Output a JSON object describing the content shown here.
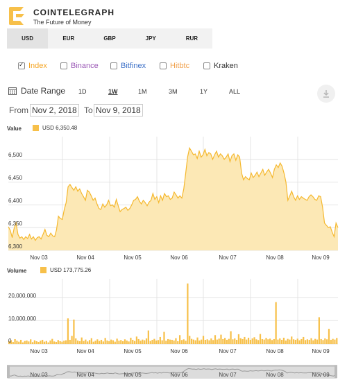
{
  "header": {
    "brand": "COINTELEGRAPH",
    "tagline": "The Future of Money"
  },
  "currencies": [
    {
      "label": "USD",
      "active": true
    },
    {
      "label": "EUR",
      "active": false
    },
    {
      "label": "GBP",
      "active": false
    },
    {
      "label": "JPY",
      "active": false
    },
    {
      "label": "RUR",
      "active": false
    }
  ],
  "exchanges": [
    {
      "label": "Index",
      "checked": true,
      "color": "#f5a524"
    },
    {
      "label": "Binance",
      "checked": false,
      "color": "#9b59b6"
    },
    {
      "label": "Bitfinex",
      "checked": false,
      "color": "#3b6fc7"
    },
    {
      "label": "Hitbtc",
      "checked": false,
      "color": "#f0a04b"
    },
    {
      "label": "Kraken",
      "checked": false,
      "color": "#333333"
    }
  ],
  "date_range": {
    "label": "Date Range",
    "ranges": [
      {
        "label": "1D",
        "active": false
      },
      {
        "label": "1W",
        "active": true
      },
      {
        "label": "1M",
        "active": false
      },
      {
        "label": "3M",
        "active": false
      },
      {
        "label": "1Y",
        "active": false
      },
      {
        "label": "ALL",
        "active": false
      }
    ],
    "from_label": "From",
    "from_value": "Nov 2, 2018",
    "to_label": "To",
    "to_value": "Nov 9, 2018"
  },
  "icons": {
    "logo": "cointelegraph-logo-icon",
    "calendar": "calendar-icon",
    "download": "download-icon"
  },
  "colors": {
    "accent": "#f7c04a",
    "line": "#f5b82e",
    "fill": "#fce8b5"
  },
  "chart_data": [
    {
      "type": "area",
      "title": "Value",
      "legend": "USD 6,350.48",
      "yticks": [
        "6,500",
        "6,450",
        "6,400",
        "6,350",
        "6,300"
      ],
      "ylim": [
        6300,
        6550
      ],
      "xticks": [
        "Nov 03",
        "Nov 04",
        "Nov 05",
        "Nov 06",
        "Nov 07",
        "Nov 08",
        "Nov 09"
      ],
      "values": [
        6352,
        6344,
        6328,
        6348,
        6360,
        6335,
        6327,
        6330,
        6324,
        6330,
        6326,
        6335,
        6325,
        6330,
        6322,
        6328,
        6330,
        6325,
        6335,
        6346,
        6333,
        6330,
        6338,
        6332,
        6330,
        6345,
        6375,
        6370,
        6368,
        6390,
        6405,
        6440,
        6445,
        6438,
        6432,
        6440,
        6430,
        6435,
        6425,
        6418,
        6410,
        6432,
        6428,
        6420,
        6410,
        6415,
        6402,
        6392,
        6390,
        6402,
        6395,
        6400,
        6410,
        6398,
        6400,
        6395,
        6412,
        6398,
        6385,
        6390,
        6392,
        6395,
        6388,
        6392,
        6400,
        6410,
        6412,
        6418,
        6408,
        6402,
        6410,
        6405,
        6398,
        6406,
        6410,
        6425,
        6412,
        6418,
        6405,
        6420,
        6410,
        6425,
        6418,
        6420,
        6412,
        6415,
        6428,
        6422,
        6415,
        6420,
        6415,
        6435,
        6470,
        6505,
        6525,
        6518,
        6510,
        6512,
        6502,
        6518,
        6505,
        6510,
        6522,
        6508,
        6515,
        6512,
        6500,
        6510,
        6518,
        6505,
        6512,
        6508,
        6500,
        6505,
        6512,
        6495,
        6508,
        6512,
        6498,
        6510,
        6505,
        6470,
        6455,
        6462,
        6458,
        6455,
        6470,
        6460,
        6465,
        6472,
        6462,
        6470,
        6478,
        6465,
        6472,
        6478,
        6470,
        6460,
        6478,
        6488,
        6482,
        6492,
        6485,
        6470,
        6450,
        6410,
        6420,
        6430,
        6418,
        6410,
        6420,
        6412,
        6418,
        6415,
        6412,
        6410,
        6418,
        6422,
        6418,
        6412,
        6410,
        6420,
        6418,
        6395,
        6360,
        6355,
        6350,
        6352,
        6340,
        6330,
        6360,
        6350
      ]
    },
    {
      "type": "bar",
      "title": "Volume",
      "legend": "USD 173,775.26",
      "yticks": [
        "20,000,000",
        "10,000,000",
        "0"
      ],
      "ylim": [
        0,
        28000000
      ],
      "xticks": [
        "Nov 03",
        "Nov 04",
        "Nov 05",
        "Nov 06",
        "Nov 07",
        "Nov 08",
        "Nov 09"
      ],
      "values": [
        1200000,
        1600000,
        900000,
        2100000,
        1400000,
        1000000,
        1800000,
        700000,
        1300000,
        1500000,
        1100000,
        2000000,
        800000,
        1600000,
        1200000,
        900000,
        1400000,
        1800000,
        1000000,
        1300000,
        700000,
        1500000,
        2200000,
        1100000,
        900000,
        1700000,
        1200000,
        1000000,
        1400000,
        1600000,
        11000000,
        1800000,
        3500000,
        10500000,
        2400000,
        1500000,
        1200000,
        2800000,
        1300000,
        1900000,
        1100000,
        1700000,
        2500000,
        1000000,
        1400000,
        2000000,
        1300000,
        1800000,
        1100000,
        2600000,
        1500000,
        1200000,
        1900000,
        1600000,
        1000000,
        2300000,
        1400000,
        1700000,
        1200000,
        2000000,
        1500000,
        1100000,
        2700000,
        1800000,
        1300000,
        3200000,
        2100000,
        1400000,
        1900000,
        1600000,
        2400000,
        5800000,
        1300000,
        1800000,
        2200000,
        1500000,
        1700000,
        3000000,
        1600000,
        5200000,
        1400000,
        2100000,
        1900000,
        1800000,
        1500000,
        2500000,
        1200000,
        3800000,
        1700000,
        2000000,
        1400000,
        26000000,
        3500000,
        2200000,
        1900000,
        1600000,
        2800000,
        1500000,
        1900000,
        3500000,
        1800000,
        2000000,
        1600000,
        2400000,
        1700000,
        3800000,
        1900000,
        2300000,
        4000000,
        2100000,
        2600000,
        1800000,
        2200000,
        5500000,
        2000000,
        2400000,
        1800000,
        4200000,
        2500000,
        2100000,
        3000000,
        1900000,
        2700000,
        1800000,
        2400000,
        2900000,
        2000000,
        1700000,
        4300000,
        2100000,
        1900000,
        2600000,
        2000000,
        2300000,
        1700000,
        2100000,
        18000000,
        1900000,
        2400000,
        1800000,
        2700000,
        1500000,
        2200000,
        1900000,
        3200000,
        2000000,
        1800000,
        2300000,
        1600000,
        2100000,
        3000000,
        1700000,
        2000000,
        1800000,
        2500000,
        1600000,
        2200000,
        1900000,
        11500000,
        2100000,
        1700000,
        2400000,
        2000000,
        6500000,
        1800000,
        2200000,
        1900000,
        2600000
      ]
    }
  ]
}
